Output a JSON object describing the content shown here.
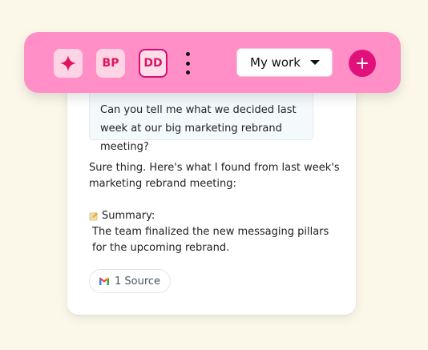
{
  "toolbar": {
    "sparkle_icon": "sparkle-icon",
    "avatar_bp": "BP",
    "avatar_dd": "DD",
    "more_icon": "vertical-dots-icon",
    "workspace_select": "My work",
    "add_icon": "plus-icon",
    "colors": {
      "bar": "#ff8fc6",
      "accent": "#e0117a",
      "chip_bg": "#ffd4e5"
    }
  },
  "chat": {
    "user_message": "Can you tell me what we decided last week at our big marketing rebrand meeting?",
    "reply_intro": "Sure thing. Here's what I found from last week's marketing rebrand meeting:",
    "summary_icon": "memo-icon",
    "summary_label": "Summary:",
    "summary_text": "The team finalized the new messaging pillars for the upcoming rebrand.",
    "source_icon": "gmail-icon",
    "source_label": "1 Source"
  }
}
